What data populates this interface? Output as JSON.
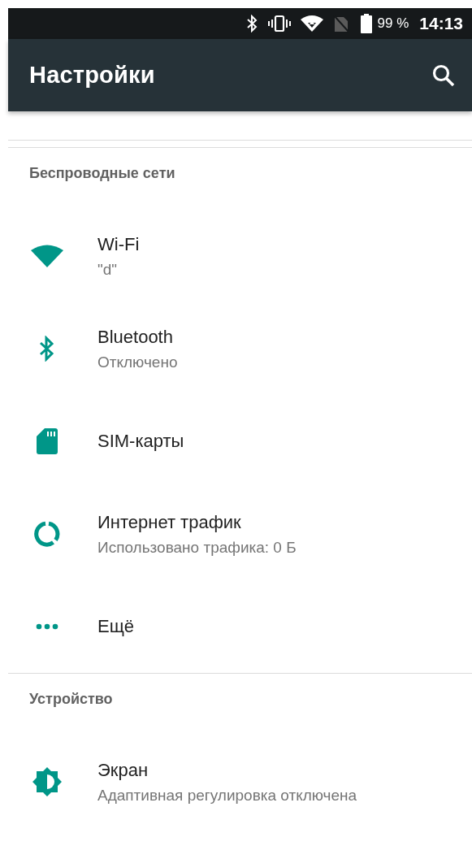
{
  "status_bar": {
    "battery_text": "99 %",
    "time": "14:13"
  },
  "toolbar": {
    "title": "Настройки"
  },
  "sections": [
    {
      "header": "Беспроводные сети",
      "items": [
        {
          "kind": "wifi",
          "title": "Wi-Fi",
          "subtitle": "\"d\""
        },
        {
          "kind": "bluetooth",
          "title": "Bluetooth",
          "subtitle": "Отключено"
        },
        {
          "kind": "sim",
          "title": "SIM-карты"
        },
        {
          "kind": "data",
          "title": "Интернет трафик",
          "subtitle": "Использовано трафика: 0 Б"
        },
        {
          "kind": "more",
          "title": "Ещё"
        }
      ]
    },
    {
      "header": "Устройство",
      "items": [
        {
          "kind": "display",
          "title": "Экран",
          "subtitle": "Адаптивная регулировка отключена"
        }
      ]
    }
  ]
}
